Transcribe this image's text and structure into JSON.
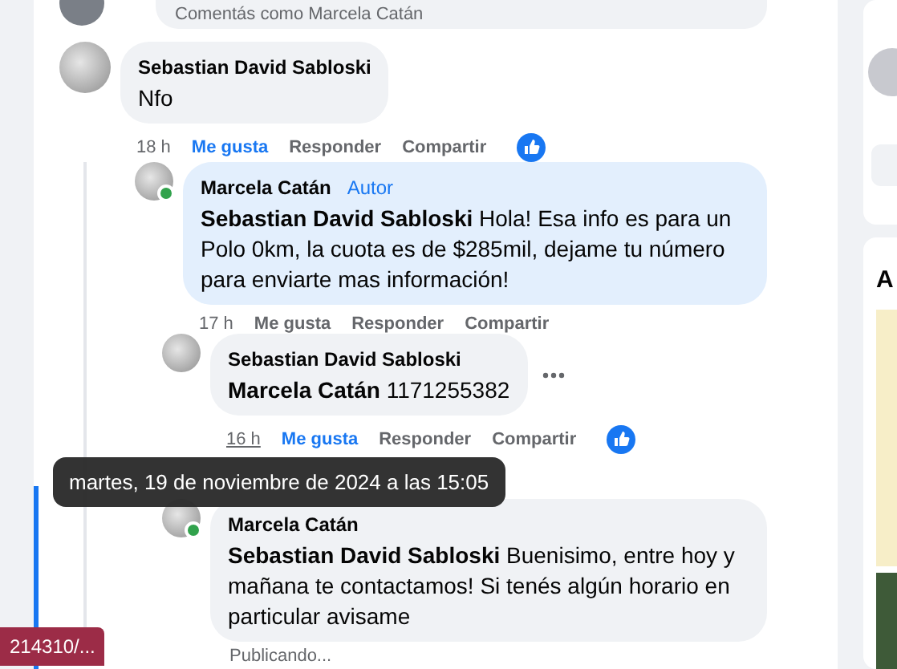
{
  "composer": {
    "placeholder": "Comentás como Marcela Catán"
  },
  "comments": [
    {
      "author": "Sebastian David Sabloski",
      "text": "Nfo",
      "time": "18 h",
      "liked": true,
      "reaction": true,
      "actions": [
        "Me gusta",
        "Responder",
        "Compartir"
      ],
      "children": [
        {
          "author": "Marcela Catán",
          "badge": "Autor",
          "online": true,
          "highlighted": true,
          "mention": "Sebastian David Sabloski",
          "text": "Hola! Esa info es para un Polo 0km, la cuota es de $285mil, dejame tu número para enviarte mas información!",
          "time": "17 h",
          "liked": false,
          "actions": [
            "Me gusta",
            "Responder",
            "Compartir"
          ],
          "children": [
            {
              "author": "Sebastian David Sabloski",
              "mention": "Marcela Catán",
              "text": "1171255382",
              "time": "16 h",
              "time_hovered": true,
              "liked": true,
              "reaction": true,
              "more_menu": true,
              "actions": [
                "Me gusta",
                "Responder",
                "Compartir"
              ]
            },
            {
              "author": "Marcela Catán",
              "online": true,
              "mention": "Sebastian David Sabloski",
              "text": "Buenisimo, entre hoy y mañana te contactamos! Si tenés algún horario en particular avisame",
              "status": "Publicando..."
            }
          ]
        }
      ]
    }
  ],
  "tooltip": "martes, 19 de noviembre de 2024 a las 15:05",
  "link_tag": "214310/...",
  "side": {
    "heading": "A"
  }
}
